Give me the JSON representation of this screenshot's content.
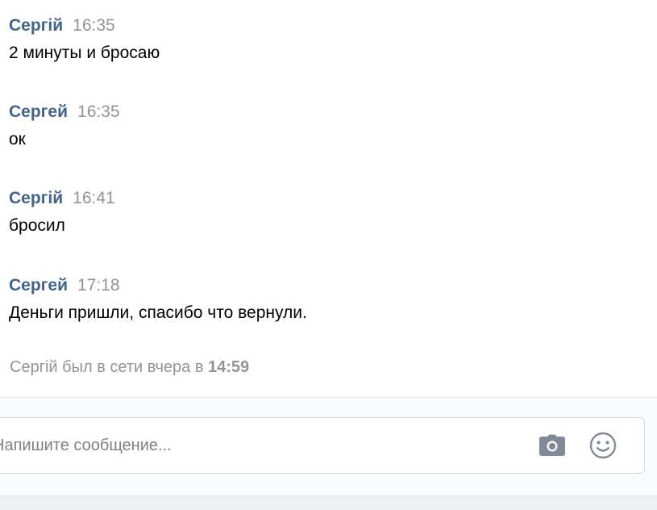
{
  "messages": [
    {
      "author": "Сергій",
      "time": "16:35",
      "text": "2 минуты и бросаю"
    },
    {
      "author": "Сергей",
      "time": "16:35",
      "text": "ок"
    },
    {
      "author": "Сергій",
      "time": "16:41",
      "text": "бросил"
    },
    {
      "author": "Сергей",
      "time": "17:18",
      "text": "Деньги пришли, спасибо что вернули."
    }
  ],
  "status": {
    "prefix": "Сергій был в сети вчера в ",
    "time": "14:59"
  },
  "composer": {
    "placeholder": "Напишите сообщение...",
    "value": ""
  },
  "icons": {
    "attach_photo": "camera-icon",
    "emoji": "smile-icon"
  },
  "colors": {
    "author": "#42648b",
    "timestamp": "#939393",
    "icon": "#828a99"
  }
}
